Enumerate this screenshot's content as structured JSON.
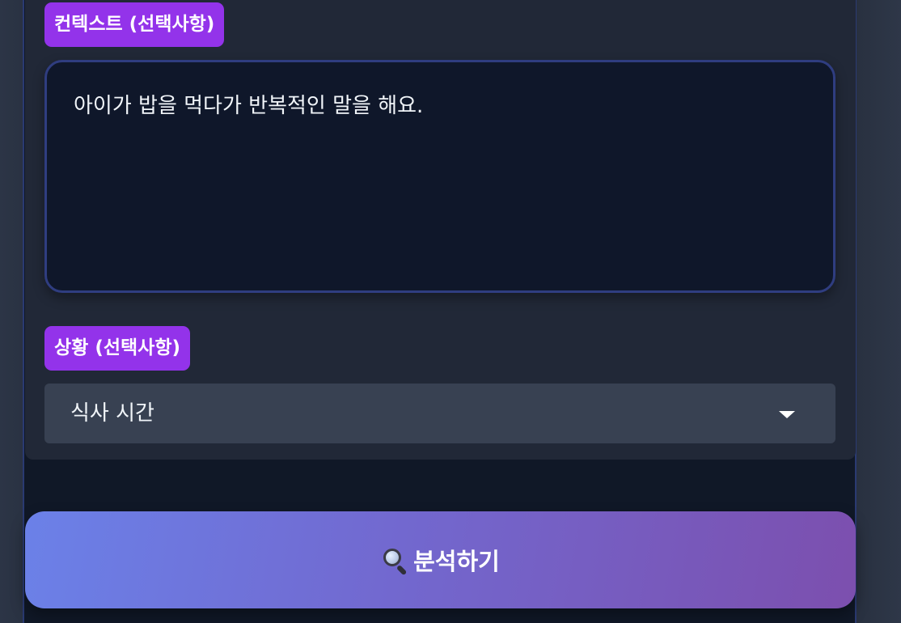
{
  "context_section": {
    "label": "컨텍스트 (선택사항)",
    "textarea_value": "아이가 밥을 먹다가 반복적인 말을 해요."
  },
  "situation_section": {
    "label": "상황 (선택사항)",
    "selected_value": "식사 시간",
    "caret_icon": "caret-down-icon"
  },
  "analyze_button": {
    "icon": "search-icon",
    "label": "분석하기"
  },
  "colors": {
    "badge": "#9333ea",
    "button_gradient_start": "#6b81e8",
    "button_gradient_end": "#7c4fae",
    "textarea_border": "#2f3d80",
    "select_background": "#384152"
  }
}
